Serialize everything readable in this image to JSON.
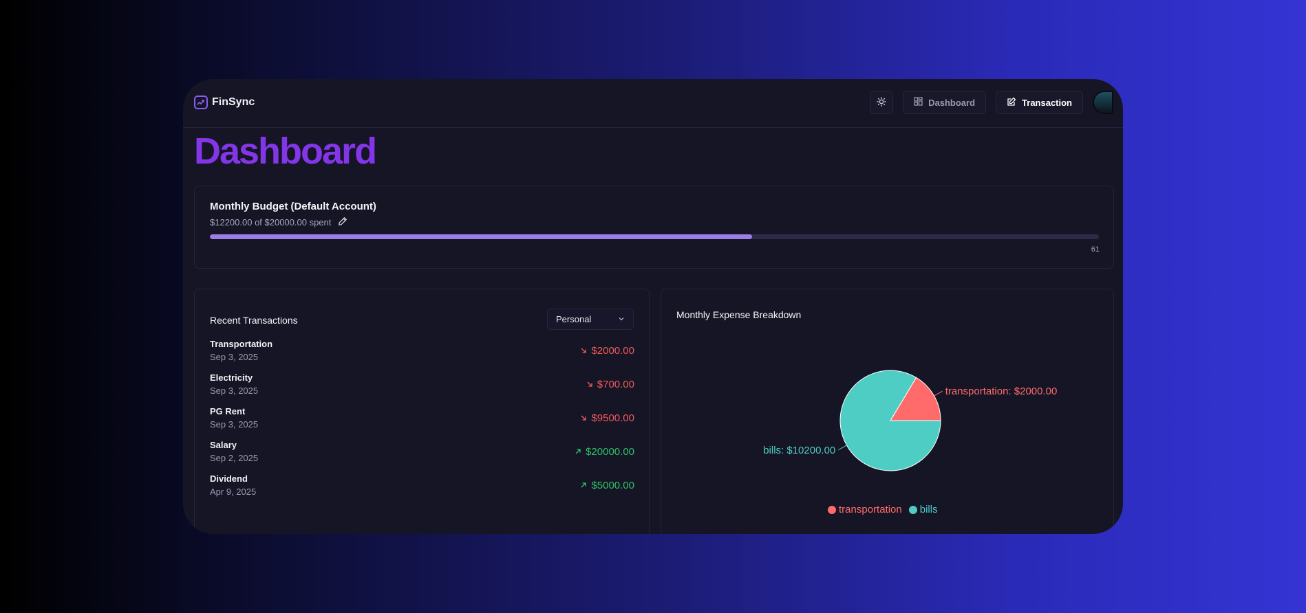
{
  "app": {
    "name": "FinSync"
  },
  "nav": {
    "theme_icon": "sun-icon",
    "dashboard_label": "Dashboard",
    "transaction_label": "Transaction"
  },
  "page": {
    "title": "Dashboard"
  },
  "budget": {
    "title": "Monthly Budget (Default Account)",
    "spent_text": "$12200.00 of $20000.00 spent",
    "percent": 61,
    "percent_label": "61"
  },
  "transactions": {
    "title": "Recent Transactions",
    "account_select": "Personal",
    "items": [
      {
        "name": "Transportation",
        "date": "Sep 3, 2025",
        "amount": "$2000.00",
        "type": "expense"
      },
      {
        "name": "Electricity",
        "date": "Sep 3, 2025",
        "amount": "$700.00",
        "type": "expense"
      },
      {
        "name": "PG Rent",
        "date": "Sep 3, 2025",
        "amount": "$9500.00",
        "type": "expense"
      },
      {
        "name": "Salary",
        "date": "Sep 2, 2025",
        "amount": "$20000.00",
        "type": "income"
      },
      {
        "name": "Dividend",
        "date": "Apr 9, 2025",
        "amount": "$5000.00",
        "type": "income"
      }
    ]
  },
  "expense_chart": {
    "title": "Monthly Expense Breakdown"
  },
  "chart_data": {
    "type": "pie",
    "title": "Monthly Expense Breakdown",
    "slices": [
      {
        "name": "transportation",
        "value": 2000,
        "label": "transportation: $2000.00",
        "color": "#ff6b6b"
      },
      {
        "name": "bills",
        "value": 10200,
        "label": "bills: $10200.00",
        "color": "#4ecdc4"
      }
    ],
    "legend": "bottom"
  },
  "colors": {
    "brand": "#8236e8",
    "expense": "#f25a5a",
    "income": "#2fc26a",
    "progress": "#9a7ee6"
  }
}
